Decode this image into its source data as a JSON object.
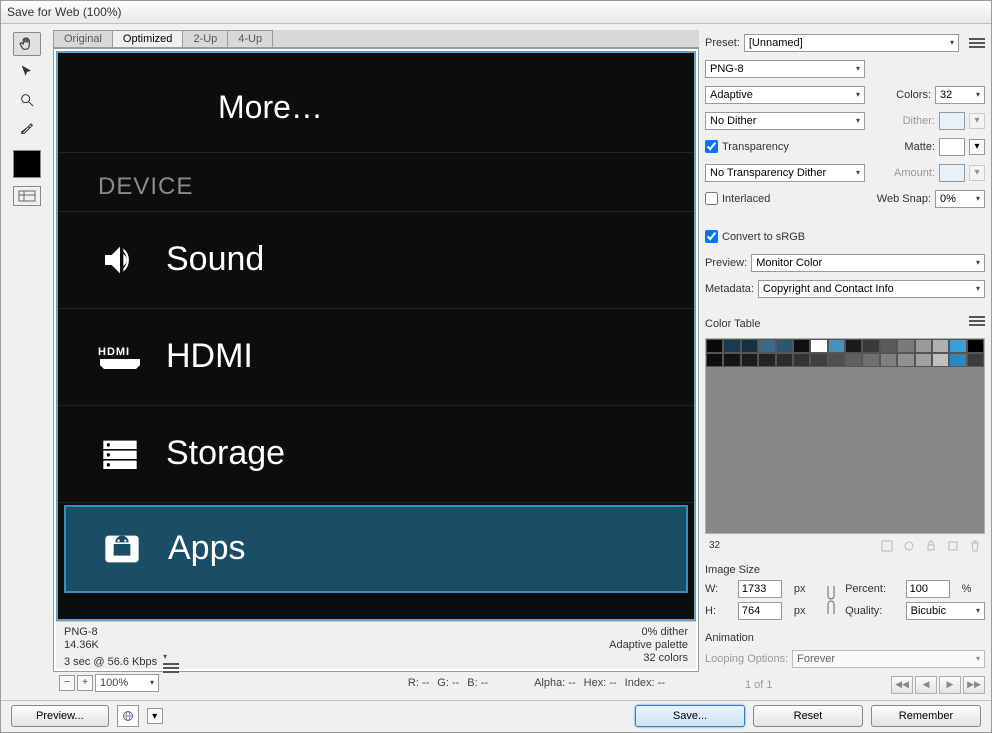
{
  "window": {
    "title": "Save for Web (100%)"
  },
  "tabs": {
    "original": "Original",
    "optimized": "Optimized",
    "twoup": "2-Up",
    "fourup": "4-Up"
  },
  "android": {
    "more": "More…",
    "device_header": "DEVICE",
    "sound": "Sound",
    "hdmi": "HDMI",
    "storage": "Storage",
    "apps": "Apps"
  },
  "preview_footer": {
    "format": "PNG-8",
    "size": "14.36K",
    "timing": "3 sec @ 56.6 Kbps",
    "dither": "0% dither",
    "palette": "Adaptive palette",
    "colors": "32 colors"
  },
  "status": {
    "zoom": "100%",
    "r": "R: --",
    "g": "G: --",
    "b": "B: --",
    "alpha": "Alpha: --",
    "hex": "Hex: --",
    "index": "Index: --"
  },
  "settings": {
    "preset_label": "Preset:",
    "preset": "[Unnamed]",
    "format": "PNG-8",
    "palette": "Adaptive",
    "colors_label": "Colors:",
    "colors": "32",
    "dither_mode": "No Dither",
    "dither_label": "Dither:",
    "transparency": "Transparency",
    "matte_label": "Matte:",
    "trans_dither": "No Transparency Dither",
    "amount_label": "Amount:",
    "interlaced": "Interlaced",
    "websnap_label": "Web Snap:",
    "websnap": "0%",
    "convert_srgb": "Convert to sRGB",
    "preview_label": "Preview:",
    "preview": "Monitor Color",
    "metadata_label": "Metadata:",
    "metadata": "Copyright and Contact Info",
    "color_table_label": "Color Table",
    "color_count": "32",
    "image_size_label": "Image Size",
    "w_label": "W:",
    "w": "1733",
    "h_label": "H:",
    "h": "764",
    "px": "px",
    "percent_label": "Percent:",
    "percent": "100",
    "pct_sym": "%",
    "quality_label": "Quality:",
    "quality": "Bicubic",
    "animation_label": "Animation",
    "looping_label": "Looping Options:",
    "looping": "Forever",
    "frame": "1 of 1"
  },
  "color_table": {
    "swatches": [
      "#0a0a0a",
      "#1a3a50",
      "#163040",
      "#3a6a88",
      "#2a5870",
      "#101010",
      "#ffffff",
      "#4a90b8",
      "#1a1a1a",
      "#3a3a3a",
      "#5a5a5a",
      "#7a7a7a",
      "#9a9a9a",
      "#b0b0b0",
      "#3a9fd8",
      "#000000",
      "#0d0d0d",
      "#141414",
      "#1c1c1c",
      "#242424",
      "#2c2c2c",
      "#343434",
      "#404040",
      "#505050",
      "#606060",
      "#707070",
      "#808080",
      "#909090",
      "#a0a0a0",
      "#c0c0c0",
      "#2a8ac0",
      "#3c3c3c"
    ]
  },
  "buttons": {
    "preview": "Preview...",
    "save": "Save...",
    "reset": "Reset",
    "remember": "Remember"
  }
}
